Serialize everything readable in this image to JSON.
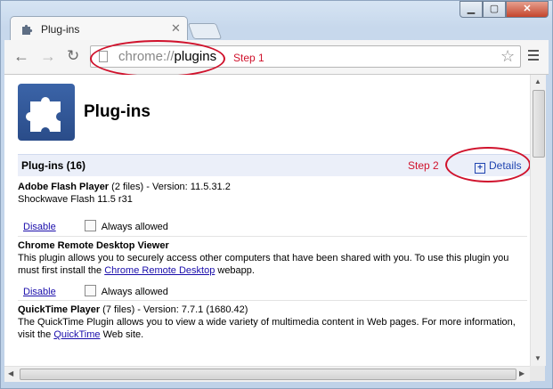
{
  "tab": {
    "title": "Plug-ins",
    "close": "✕"
  },
  "window_controls": {
    "minimize": "▁",
    "maximize": "▢",
    "close": "✕"
  },
  "toolbar": {
    "back": "←",
    "forward": "→",
    "reload": "↻",
    "url_scheme": "chrome://",
    "url_host": "plugins",
    "star": "☆"
  },
  "annotations": {
    "step1": "Step 1",
    "step2": "Step 2"
  },
  "page": {
    "title": "Plug-ins",
    "section_title": "Plug-ins (16)",
    "details_label": "Details",
    "details_icon": "+"
  },
  "plugins": [
    {
      "name": "Adobe Flash Player",
      "meta": " (2 files) - Version: 11.5.31.2",
      "line2": "Shockwave Flash 11.5 r31",
      "disable_label": "Disable",
      "always_allowed_label": "Always allowed"
    },
    {
      "name": "Chrome Remote Desktop Viewer",
      "desc_a": "This plugin allows you to securely access other computers that have been shared with you. To use this plugin you must first install the ",
      "link": "Chrome Remote Desktop",
      "desc_b": " webapp.",
      "disable_label": "Disable",
      "always_allowed_label": "Always allowed"
    },
    {
      "name": "QuickTime Player",
      "meta": " (7 files) - Version: 7.7.1 (1680.42)",
      "desc_a": "The QuickTime Plugin allows you to view a wide variety of multimedia content in Web pages. For more information, visit the ",
      "link": "QuickTime",
      "desc_b": " Web site."
    }
  ],
  "colors": {
    "annotation": "#d0122c",
    "link": "#1a0dab",
    "header_bg": "#ebeff9"
  },
  "icons": [
    "puzzle-icon",
    "page-icon",
    "star-icon",
    "menu-icon",
    "plus-icon"
  ]
}
